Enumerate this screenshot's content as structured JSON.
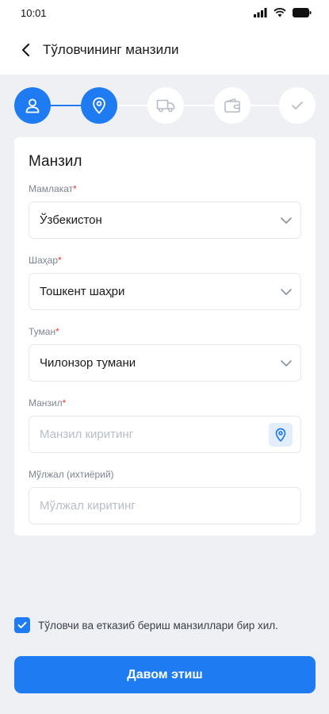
{
  "status_bar": {
    "time": "10:01"
  },
  "header": {
    "title": "Тўловчининг манзили"
  },
  "stepper": {
    "steps": [
      {
        "icon": "user-icon",
        "state": "completed"
      },
      {
        "icon": "location-pin-icon",
        "state": "current"
      },
      {
        "icon": "truck-icon",
        "state": "pending"
      },
      {
        "icon": "wallet-icon",
        "state": "pending"
      },
      {
        "icon": "check-icon",
        "state": "pending"
      }
    ]
  },
  "form": {
    "title": "Манзил",
    "country": {
      "label": "Мамлакат",
      "required_mark": "*",
      "value": "Ўзбекистон"
    },
    "city": {
      "label": "Шаҳар",
      "required_mark": "*",
      "value": "Тошкент шаҳри"
    },
    "district": {
      "label": "Туман",
      "required_mark": "*",
      "value": "Чилонзор тумани"
    },
    "address": {
      "label": "Манзил",
      "required_mark": "*",
      "value": "",
      "placeholder": "Манзил киритинг"
    },
    "landmark": {
      "label": "Мўлжал (ихтиёрий)",
      "value": "",
      "placeholder": "Мўлжал киритинг"
    }
  },
  "agreement": {
    "checked": true,
    "text": "Тўловчи ва етказиб бериш манзиллари бир хил."
  },
  "continue_button": {
    "label": "Давом этиш"
  },
  "colors": {
    "accent": "#1f7bf2",
    "required": "#e53935",
    "background": "#eef0f3"
  }
}
